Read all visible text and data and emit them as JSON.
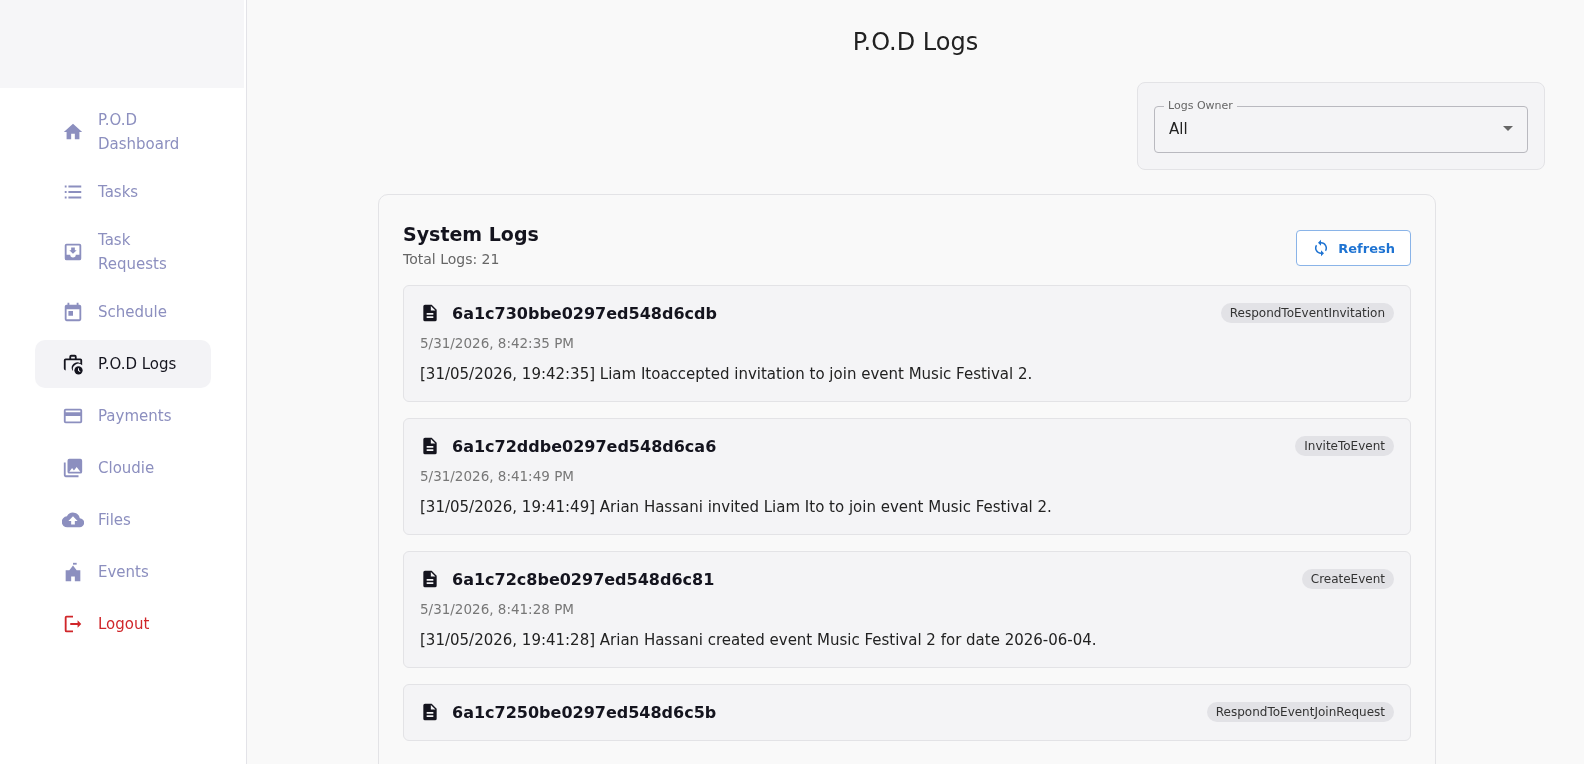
{
  "sidebar": {
    "items": [
      {
        "label": "P.O.D Dashboard",
        "selected": false,
        "kind": "nav"
      },
      {
        "label": "Tasks",
        "selected": false,
        "kind": "nav"
      },
      {
        "label": "Task Requests",
        "selected": false,
        "kind": "nav"
      },
      {
        "label": "Schedule",
        "selected": false,
        "kind": "nav"
      },
      {
        "label": "P.O.D Logs",
        "selected": true,
        "kind": "nav"
      },
      {
        "label": "Payments",
        "selected": false,
        "kind": "nav"
      },
      {
        "label": "Cloudie",
        "selected": false,
        "kind": "nav"
      },
      {
        "label": "Files",
        "selected": false,
        "kind": "nav"
      },
      {
        "label": "Events",
        "selected": false,
        "kind": "nav"
      },
      {
        "label": "Logout",
        "selected": false,
        "kind": "logout"
      }
    ]
  },
  "page_title": "P.O.D Logs",
  "filter": {
    "label": "Logs Owner",
    "value": "All"
  },
  "logs_card": {
    "title": "System Logs",
    "total": "Total Logs: 21",
    "refresh_button": "Refresh",
    "entries": [
      {
        "id": "6a1c730bbe0297ed548d6cdb",
        "tag": "RespondToEventInvitation",
        "time": "5/31/2026, 8:42:35 PM",
        "message": "[31/05/2026, 19:42:35] Liam Itoaccepted invitation to join event Music Festival 2."
      },
      {
        "id": "6a1c72ddbe0297ed548d6ca6",
        "tag": "InviteToEvent",
        "time": "5/31/2026, 8:41:49 PM",
        "message": "[31/05/2026, 19:41:49] Arian Hassani invited Liam Ito to join event Music Festival 2."
      },
      {
        "id": "6a1c72c8be0297ed548d6c81",
        "tag": "CreateEvent",
        "time": "5/31/2026, 8:41:28 PM",
        "message": "[31/05/2026, 19:41:28] Arian Hassani created event Music Festival 2 for date 2026-06-04."
      },
      {
        "id": "6a1c7250be0297ed548d6c5b",
        "tag": "RespondToEventJoinRequest"
      }
    ]
  }
}
